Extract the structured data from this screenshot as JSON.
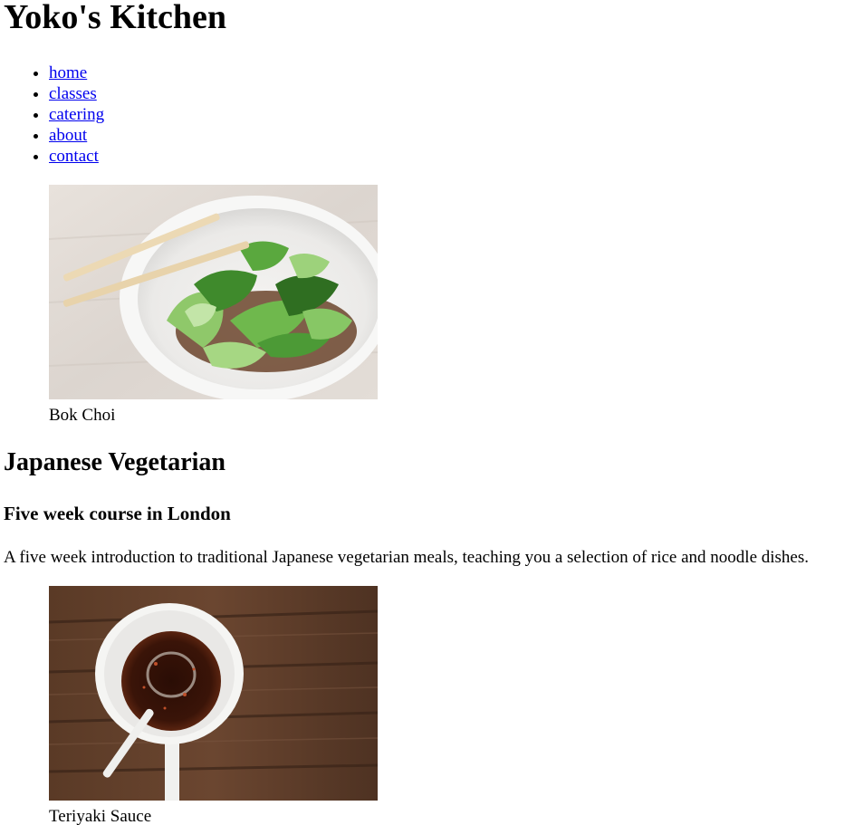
{
  "header": {
    "title": "Yoko's Kitchen"
  },
  "nav": {
    "items": [
      {
        "label": "home"
      },
      {
        "label": "classes"
      },
      {
        "label": "catering"
      },
      {
        "label": "about"
      },
      {
        "label": "contact"
      }
    ]
  },
  "figures": [
    {
      "caption": "Bok Choi",
      "image": "bok-choi-bowl-photo"
    },
    {
      "caption": "Teriyaki Sauce",
      "image": "teriyaki-sauce-cup-photo"
    }
  ],
  "course": {
    "title": "Japanese Vegetarian",
    "subtitle": "Five week course in London",
    "description": "A five week introduction to traditional Japanese vegetarian meals, teaching you a selection of rice and noodle dishes."
  },
  "colors": {
    "link": "#0000ee",
    "text": "#000000",
    "background": "#ffffff"
  }
}
